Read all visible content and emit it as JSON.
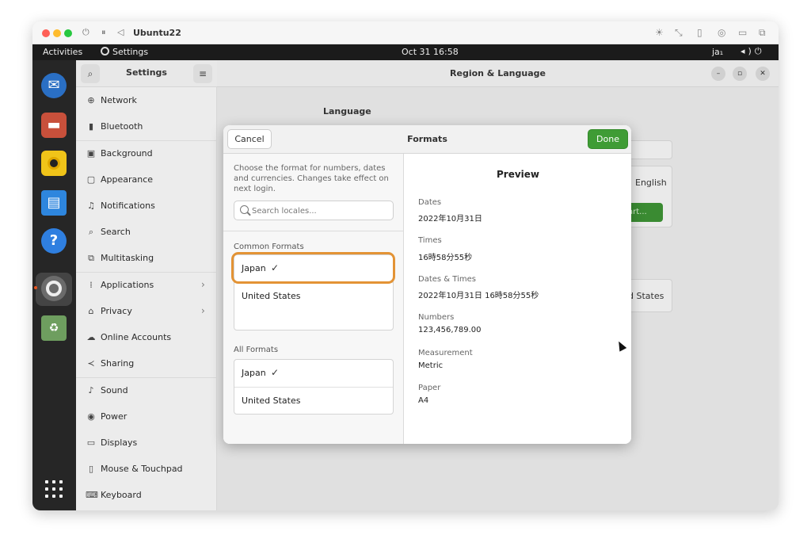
{
  "host": {
    "vm_name": "Ubuntu22"
  },
  "topbar": {
    "activities": "Activities",
    "app_menu": "Settings",
    "clock": "Oct 31  16:58",
    "input_method": "ja₁"
  },
  "settings": {
    "title": "Settings",
    "sidebar": {
      "items": [
        {
          "label": "Network",
          "icon": "network-icon"
        },
        {
          "label": "Bluetooth",
          "icon": "bluetooth-icon"
        },
        {
          "label": "Background",
          "icon": "background-icon"
        },
        {
          "label": "Appearance",
          "icon": "appearance-icon"
        },
        {
          "label": "Notifications",
          "icon": "bell-icon"
        },
        {
          "label": "Search",
          "icon": "search-icon"
        },
        {
          "label": "Multitasking",
          "icon": "multitasking-icon"
        },
        {
          "label": "Applications",
          "icon": "apps-icon"
        },
        {
          "label": "Privacy",
          "icon": "lock-icon"
        },
        {
          "label": "Online Accounts",
          "icon": "cloud-icon"
        },
        {
          "label": "Sharing",
          "icon": "share-icon"
        },
        {
          "label": "Sound",
          "icon": "music-note-icon"
        },
        {
          "label": "Power",
          "icon": "power-icon"
        },
        {
          "label": "Displays",
          "icon": "display-icon"
        },
        {
          "label": "Mouse & Touchpad",
          "icon": "mouse-icon"
        },
        {
          "label": "Keyboard",
          "icon": "keyboard-icon"
        }
      ]
    },
    "main": {
      "title": "Region & Language",
      "background": {
        "language_heading": "Language",
        "language_value": "English",
        "restart_partial": "art...",
        "formats_partial": "d States"
      }
    }
  },
  "dialog": {
    "title": "Formats",
    "cancel_label": "Cancel",
    "done_label": "Done",
    "description": "Choose the format for numbers, dates and currencies. Changes take effect on next login.",
    "search_placeholder": "Search locales...",
    "common_formats": {
      "label": "Common Formats",
      "items": [
        {
          "label": "Japan",
          "selected": true
        },
        {
          "label": "United States",
          "selected": false
        }
      ]
    },
    "all_formats": {
      "label": "All Formats",
      "items": [
        {
          "label": "Japan",
          "selected": true
        },
        {
          "label": "United States",
          "selected": false
        }
      ]
    },
    "check_glyph": "✓",
    "preview": {
      "title": "Preview",
      "dates_label": "Dates",
      "dates_value": "2022年10月31日",
      "times_label": "Times",
      "times_value": "16時58分55秒",
      "dates_times_label": "Dates & Times",
      "dates_times_value": "2022年10月31日 16時58分55秒",
      "numbers_label": "Numbers",
      "numbers_value": "123,456,789.00",
      "measurement_label": "Measurement",
      "measurement_value": "Metric",
      "paper_label": "Paper",
      "paper_value": "A4"
    }
  },
  "colors": {
    "accent_green": "#3f9c35",
    "highlight_orange": "#e39335",
    "topbar": "#1b1b1b",
    "dock": "#262626"
  }
}
